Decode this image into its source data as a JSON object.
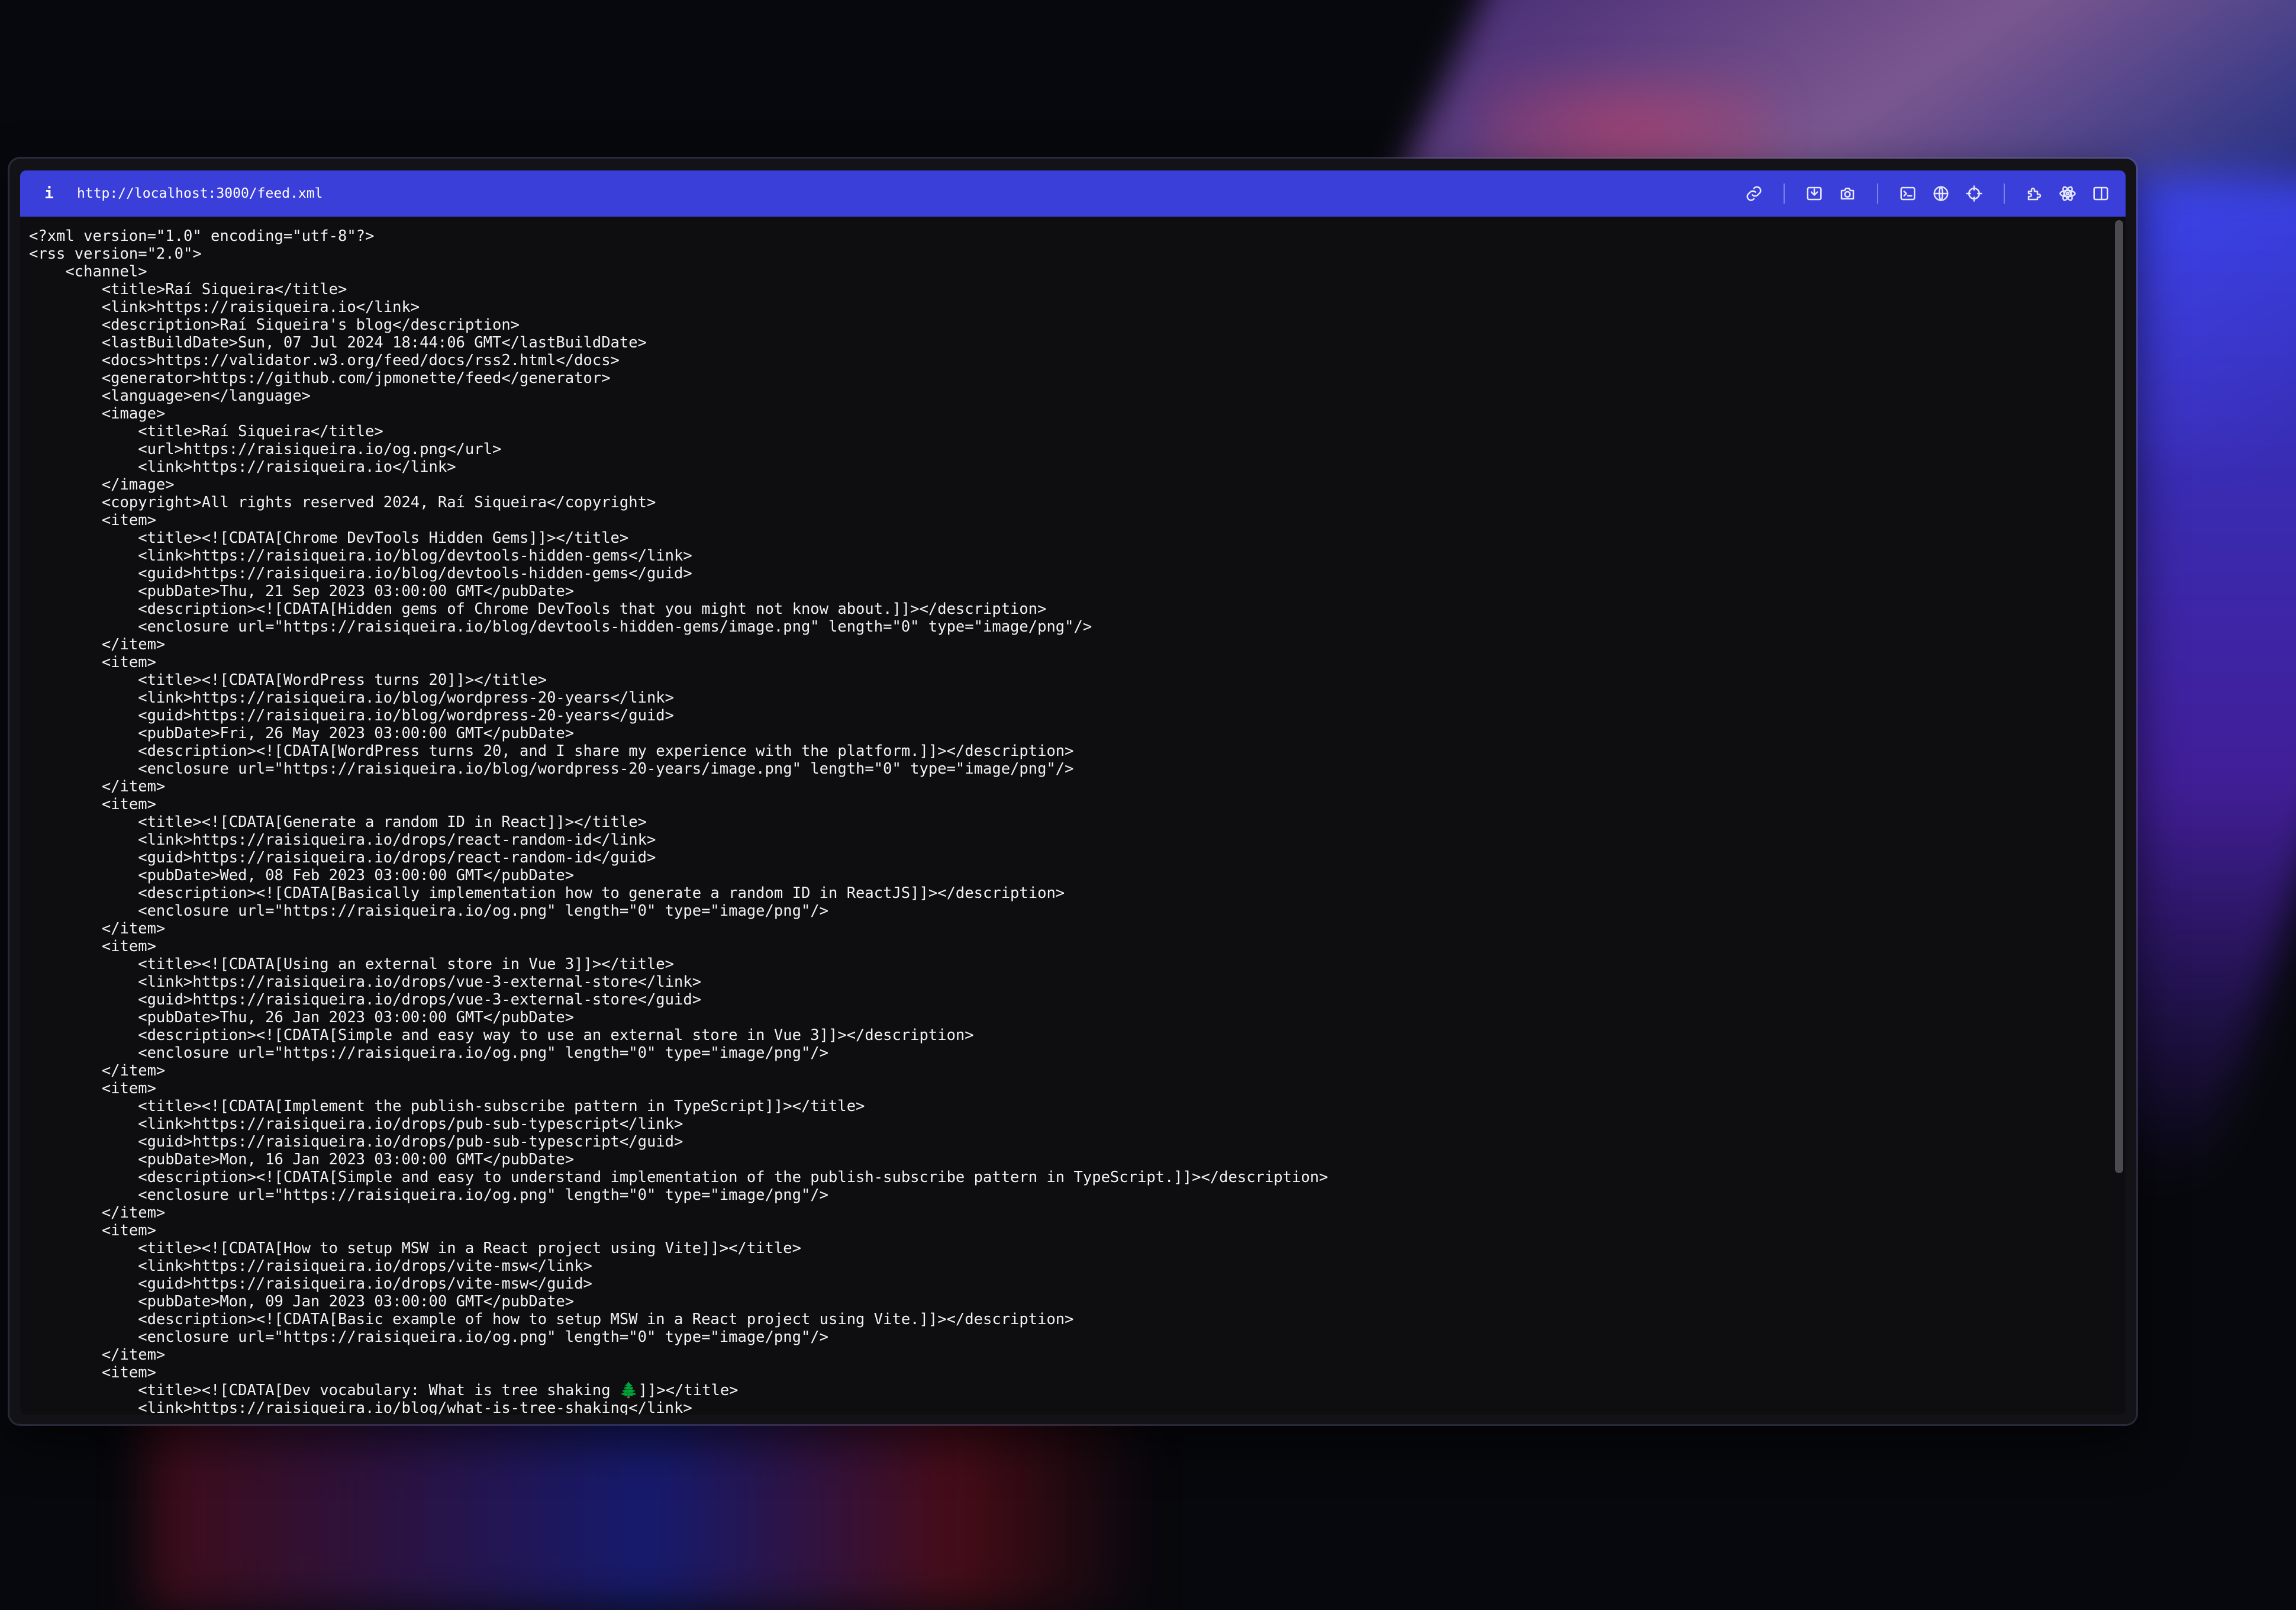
{
  "window": {
    "url": "http://localhost:3000/feed.xml",
    "info_label": "i"
  },
  "toolbar": {
    "icons": [
      "link-icon",
      "screenshot-icon",
      "camera-icon",
      "terminal-icon",
      "globe-icon",
      "crosshair-icon",
      "extension-icon",
      "react-icon",
      "split-view-icon"
    ]
  },
  "colors": {
    "toolbar": "#3b3fd9",
    "background": "#0e0e10",
    "text": "#f2f2f2"
  },
  "content": {
    "lines": [
      "<?xml version=\"1.0\" encoding=\"utf-8\"?>",
      "<rss version=\"2.0\">",
      "    <channel>",
      "        <title>Raí Siqueira</title>",
      "        <link>https://raisiqueira.io</link>",
      "        <description>Raí Siqueira's blog</description>",
      "        <lastBuildDate>Sun, 07 Jul 2024 18:44:06 GMT</lastBuildDate>",
      "        <docs>https://validator.w3.org/feed/docs/rss2.html</docs>",
      "        <generator>https://github.com/jpmonette/feed</generator>",
      "        <language>en</language>",
      "        <image>",
      "            <title>Raí Siqueira</title>",
      "            <url>https://raisiqueira.io/og.png</url>",
      "            <link>https://raisiqueira.io</link>",
      "        </image>",
      "        <copyright>All rights reserved 2024, Raí Siqueira</copyright>",
      "        <item>",
      "            <title><![CDATA[Chrome DevTools Hidden Gems]]></title>",
      "            <link>https://raisiqueira.io/blog/devtools-hidden-gems</link>",
      "            <guid>https://raisiqueira.io/blog/devtools-hidden-gems</guid>",
      "            <pubDate>Thu, 21 Sep 2023 03:00:00 GMT</pubDate>",
      "            <description><![CDATA[Hidden gems of Chrome DevTools that you might not know about.]]></description>",
      "            <enclosure url=\"https://raisiqueira.io/blog/devtools-hidden-gems/image.png\" length=\"0\" type=\"image/png\"/>",
      "        </item>",
      "        <item>",
      "            <title><![CDATA[WordPress turns 20]]></title>",
      "            <link>https://raisiqueira.io/blog/wordpress-20-years</link>",
      "            <guid>https://raisiqueira.io/blog/wordpress-20-years</guid>",
      "            <pubDate>Fri, 26 May 2023 03:00:00 GMT</pubDate>",
      "            <description><![CDATA[WordPress turns 20, and I share my experience with the platform.]]></description>",
      "            <enclosure url=\"https://raisiqueira.io/blog/wordpress-20-years/image.png\" length=\"0\" type=\"image/png\"/>",
      "        </item>",
      "        <item>",
      "            <title><![CDATA[Generate a random ID in React]]></title>",
      "            <link>https://raisiqueira.io/drops/react-random-id</link>",
      "            <guid>https://raisiqueira.io/drops/react-random-id</guid>",
      "            <pubDate>Wed, 08 Feb 2023 03:00:00 GMT</pubDate>",
      "            <description><![CDATA[Basically implementation how to generate a random ID in ReactJS]]></description>",
      "            <enclosure url=\"https://raisiqueira.io/og.png\" length=\"0\" type=\"image/png\"/>",
      "        </item>",
      "        <item>",
      "            <title><![CDATA[Using an external store in Vue 3]]></title>",
      "            <link>https://raisiqueira.io/drops/vue-3-external-store</link>",
      "            <guid>https://raisiqueira.io/drops/vue-3-external-store</guid>",
      "            <pubDate>Thu, 26 Jan 2023 03:00:00 GMT</pubDate>",
      "            <description><![CDATA[Simple and easy way to use an external store in Vue 3]]></description>",
      "            <enclosure url=\"https://raisiqueira.io/og.png\" length=\"0\" type=\"image/png\"/>",
      "        </item>",
      "        <item>",
      "            <title><![CDATA[Implement the publish-subscribe pattern in TypeScript]]></title>",
      "            <link>https://raisiqueira.io/drops/pub-sub-typescript</link>",
      "            <guid>https://raisiqueira.io/drops/pub-sub-typescript</guid>",
      "            <pubDate>Mon, 16 Jan 2023 03:00:00 GMT</pubDate>",
      "            <description><![CDATA[Simple and easy to understand implementation of the publish-subscribe pattern in TypeScript.]]></description>",
      "            <enclosure url=\"https://raisiqueira.io/og.png\" length=\"0\" type=\"image/png\"/>",
      "        </item>",
      "        <item>",
      "            <title><![CDATA[How to setup MSW in a React project using Vite]]></title>",
      "            <link>https://raisiqueira.io/drops/vite-msw</link>",
      "            <guid>https://raisiqueira.io/drops/vite-msw</guid>",
      "            <pubDate>Mon, 09 Jan 2023 03:00:00 GMT</pubDate>",
      "            <description><![CDATA[Basic example of how to setup MSW in a React project using Vite.]]></description>",
      "            <enclosure url=\"https://raisiqueira.io/og.png\" length=\"0\" type=\"image/png\"/>",
      "        </item>",
      "        <item>",
      "            <title><![CDATA[Dev vocabulary: What is tree shaking 🌲]]></title>",
      "            <link>https://raisiqueira.io/blog/what-is-tree-shaking</link>"
    ]
  }
}
